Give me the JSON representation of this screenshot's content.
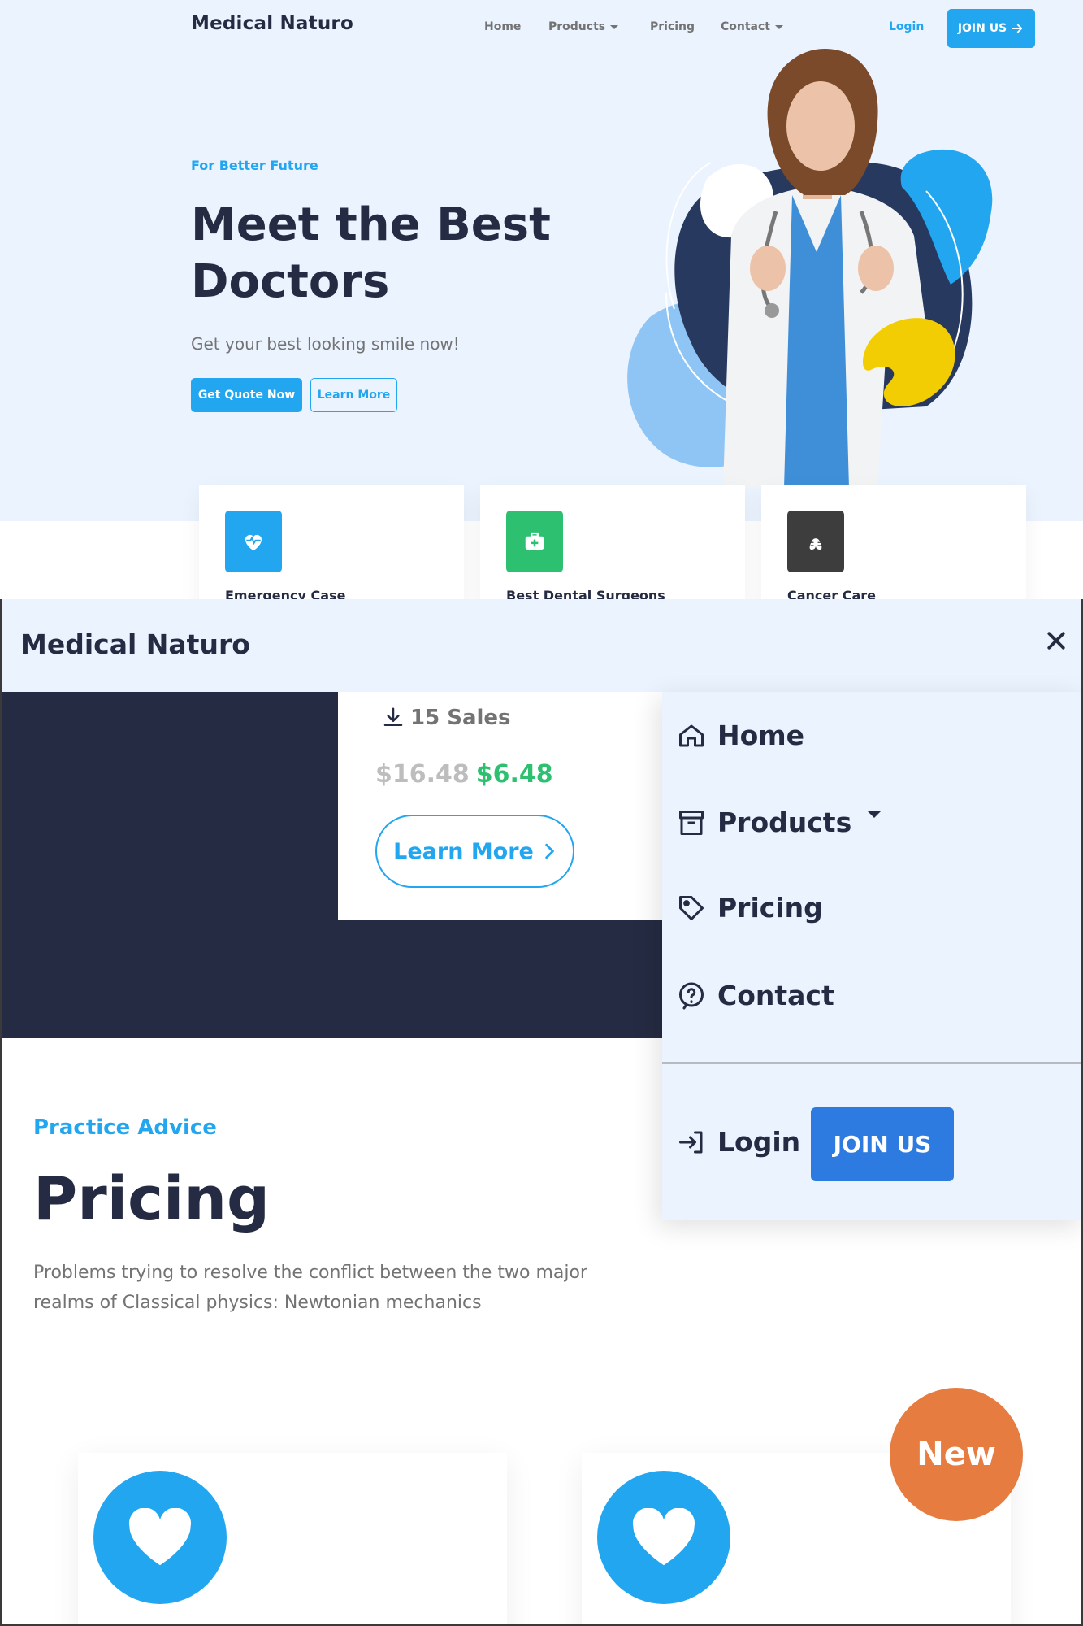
{
  "header": {
    "brand": "Medical Naturo",
    "nav": {
      "home": "Home",
      "products": "Products",
      "pricing": "Pricing",
      "contact": "Contact"
    },
    "login": "Login",
    "join": "JOIN US"
  },
  "hero": {
    "eyebrow": "For Better Future",
    "title": "Meet the Best Doctors",
    "subtitle": "Get your best looking smile now!",
    "primary_button": "Get Quote Now",
    "secondary_button": "Learn More"
  },
  "features": [
    {
      "title": "Emergency Case",
      "icon": "heart-pulse-icon",
      "color": "#23a6f0"
    },
    {
      "title": "Best Dental Surgeons",
      "icon": "medical-kit-icon",
      "color": "#2dc071"
    },
    {
      "title": "Cancer Care",
      "icon": "lungs-icon",
      "color": "#3d3d3d"
    }
  ],
  "mobile": {
    "brand": "Medical Naturo",
    "product": {
      "sales": "15 Sales",
      "old_price": "$16.48",
      "new_price": "$6.48",
      "learn_more": "Learn More"
    },
    "section": {
      "eyebrow": "Practice Advice",
      "title": "Pricing",
      "paragraph": "Problems trying to resolve the conflict between the two major realms of Classical physics: Newtonian mechanics"
    },
    "badge": "New",
    "menu": {
      "home": "Home",
      "products": "Products",
      "pricing": "Pricing",
      "contact": "Contact",
      "login": "Login",
      "join": "JOIN US"
    }
  },
  "colors": {
    "primary": "#23a6f0",
    "dark": "#252b42",
    "success": "#2dc071",
    "accent": "#e77c40",
    "hero_bg": "#eaf3fe"
  }
}
